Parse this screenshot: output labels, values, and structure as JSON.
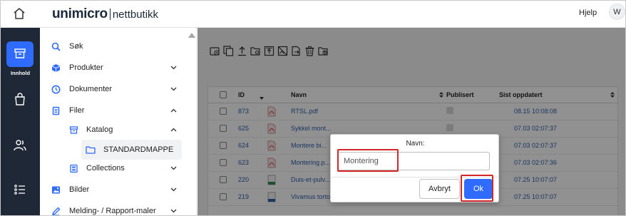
{
  "header": {
    "logo_main": "unimicro",
    "logo_sub": "nettbutikk",
    "help": "Hjelp",
    "avatar_initial": "W"
  },
  "rail": {
    "items": [
      {
        "icon": "archive-box-icon",
        "label": "Innhold",
        "active": true
      },
      {
        "icon": "shopping-bag-icon"
      },
      {
        "icon": "users-icon"
      },
      {
        "icon": "list-icon"
      }
    ]
  },
  "sidebar": {
    "items": [
      {
        "label": "Søk",
        "icon": "search-icon"
      },
      {
        "label": "Produkter",
        "icon": "cube-icon",
        "chevron": "down"
      },
      {
        "label": "Dokumenter",
        "icon": "clock-icon",
        "chevron": "down"
      },
      {
        "label": "Filer",
        "icon": "files-icon",
        "chevron": "up"
      },
      {
        "label": "Katalog",
        "icon": "archive-icon",
        "chevron": "up"
      },
      {
        "label": "STANDARDMAPPE",
        "icon": "folder-icon"
      },
      {
        "label": "Collections",
        "icon": "collection-icon",
        "chevron": "down"
      },
      {
        "label": "Bilder",
        "icon": "image-icon",
        "chevron": "down"
      },
      {
        "label": "Melding- / Rapport-maler",
        "icon": "template-icon",
        "chevron": "down"
      }
    ]
  },
  "table": {
    "columns": {
      "id": "ID",
      "name": "Navn",
      "published": "Publisert",
      "updated": "Sist oppdatert"
    },
    "rows": [
      {
        "id": "873",
        "name": "RTSL.pdf",
        "type": "pdf",
        "updated": "08.15 10:08:08"
      },
      {
        "id": "625",
        "name": "Sykkel mont...",
        "type": "pdf",
        "updated": "07.03 02:07:37"
      },
      {
        "id": "624",
        "name": "Montere bi...",
        "type": "pdf",
        "updated": "07.03 02:07:37"
      },
      {
        "id": "623",
        "name": "Montering.p...",
        "type": "pdf",
        "updated": "07.03 02:07:36"
      },
      {
        "id": "220",
        "name": "Duis-et-pulv...",
        "type": "sheet",
        "updated": "07.25 10:07:07"
      },
      {
        "id": "219",
        "name": "Vivamus tortor neque.docx",
        "type": "doc",
        "updated": "07.25 10:07:07"
      }
    ]
  },
  "dialog": {
    "label": "Navn:",
    "input_value": "Montering",
    "cancel": "Avbryt",
    "ok": "Ok"
  },
  "colors": {
    "accent": "#2f6bff",
    "rail_bg": "#1e2837",
    "highlight": "#d32626"
  }
}
